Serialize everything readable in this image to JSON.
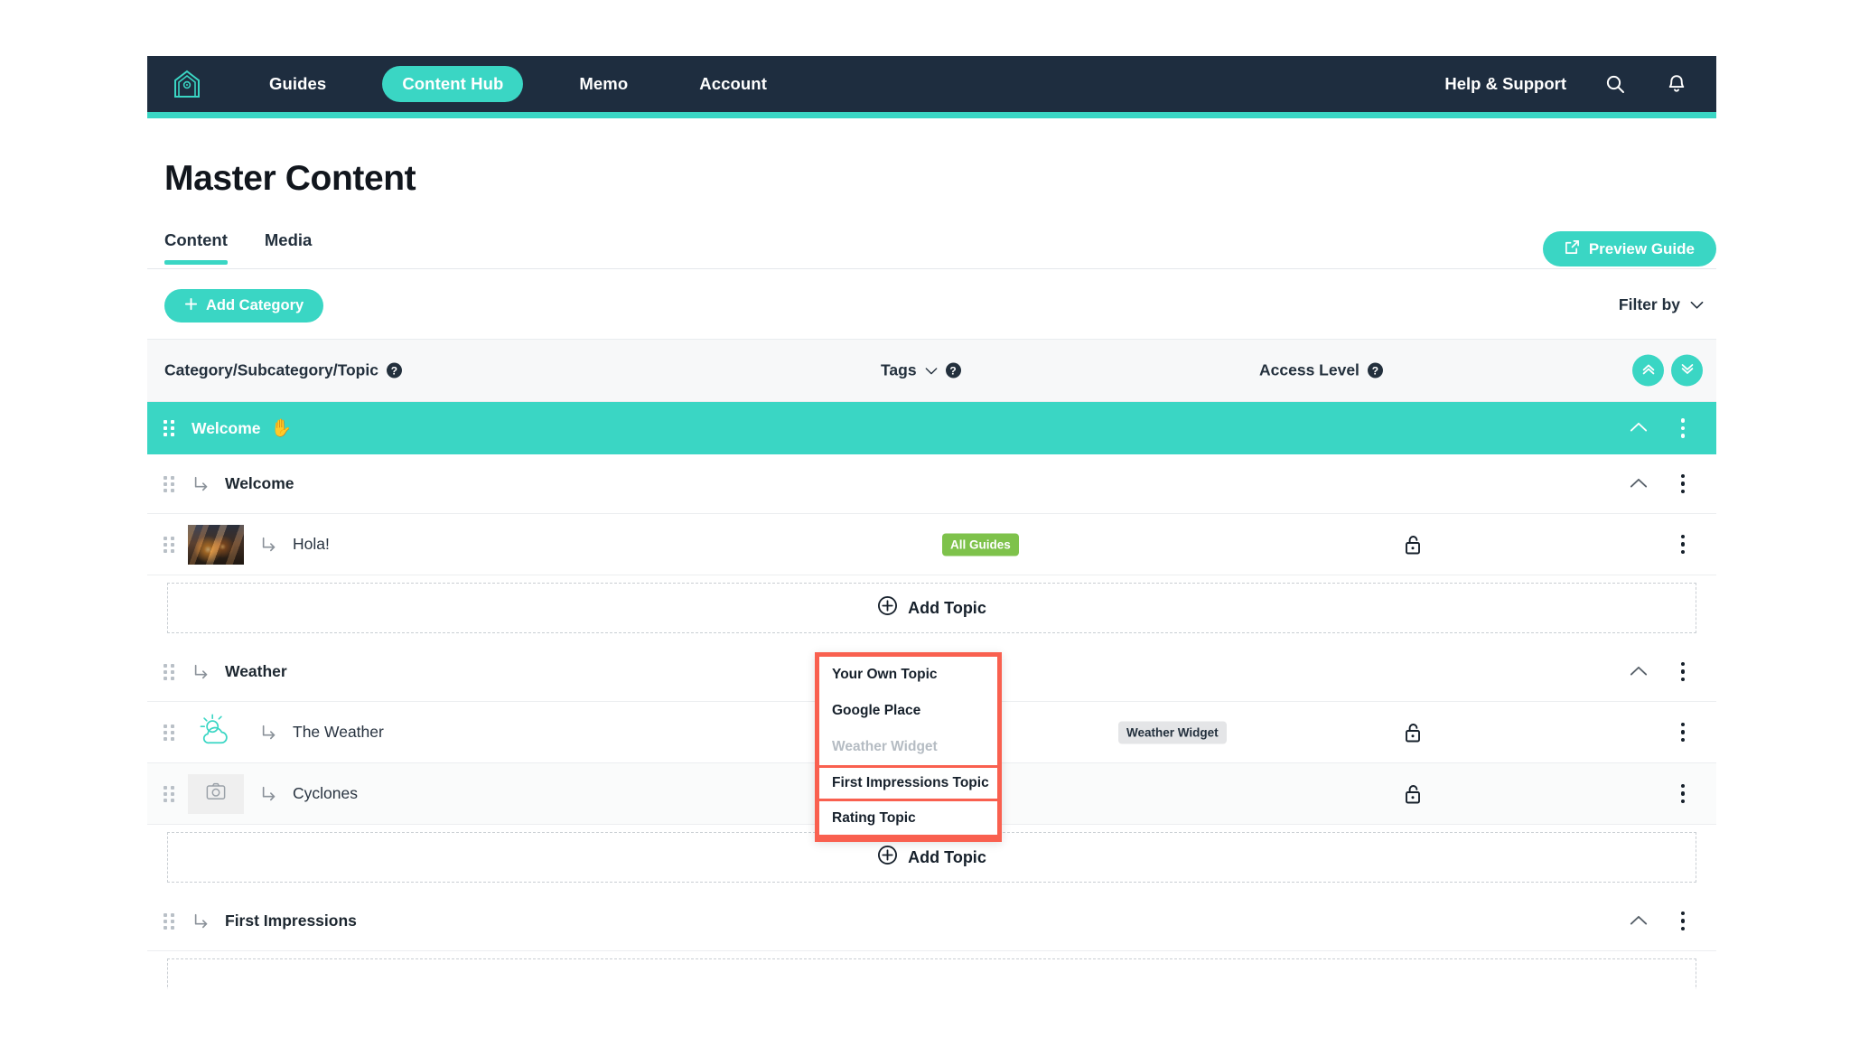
{
  "colors": {
    "brand_teal": "#3ad6c4",
    "navbar_dark": "#1e2d3f",
    "badge_green": "#7ec24b",
    "badge_gray": "#e4e5e7",
    "highlight_red": "#f9604f",
    "text_dark": "#16202b"
  },
  "navbar": {
    "home_icon": "home-icon",
    "links": [
      {
        "label": "Guides",
        "active": false
      },
      {
        "label": "Content Hub",
        "active": true
      },
      {
        "label": "Memo",
        "active": false
      },
      {
        "label": "Account",
        "active": false
      }
    ],
    "help_label": "Help & Support",
    "search_icon": "search-icon",
    "bell_icon": "bell-icon"
  },
  "header": {
    "title": "Master Content",
    "tabs": [
      {
        "label": "Content",
        "active": true
      },
      {
        "label": "Media",
        "active": false
      }
    ],
    "preview_button": "Preview Guide",
    "preview_icon": "external-link-icon"
  },
  "toolbar": {
    "add_category_label": "Add Category",
    "add_category_icon": "plus-icon",
    "filter_label": "Filter by",
    "filter_icon": "chevron-down-icon"
  },
  "table_header": {
    "category_col": "Category/Subcategory/Topic",
    "tags_col": "Tags",
    "access_col": "Access Level",
    "help_glyph": "?",
    "expand_all_icon": "double-chevron-up-icon",
    "collapse_all_icon": "double-chevron-down-icon"
  },
  "add_topic": {
    "label": "Add Topic",
    "icon": "plus-circle-icon"
  },
  "tree": [
    {
      "type": "category",
      "label": "Welcome",
      "emoji": "✋",
      "collapse_icon": "chevron-up-icon",
      "menu_icon": "kebab-menu-icon"
    },
    {
      "type": "subcategory",
      "label": "Welcome",
      "collapse_icon": "chevron-up-icon",
      "menu_icon": "kebab-menu-icon"
    },
    {
      "type": "topic",
      "label": "Hola!",
      "thumbnail": "photo-thumbnail",
      "tag": "All Guides",
      "tag_style": "green",
      "access_icon": "unlocked-padlock-icon",
      "menu_icon": "kebab-menu-icon"
    },
    {
      "type": "add_topic"
    },
    {
      "type": "subcategory",
      "label": "Weather",
      "collapse_icon": "chevron-up-icon",
      "menu_icon": "kebab-menu-icon"
    },
    {
      "type": "topic",
      "label": "The Weather",
      "thumbnail": "sun-cloud-icon",
      "tag": "Weather Widget",
      "tag_style": "gray",
      "access_icon": "unlocked-padlock-icon",
      "menu_icon": "kebab-menu-icon"
    },
    {
      "type": "topic",
      "label": "Cyclones",
      "thumbnail": "camera-placeholder-icon",
      "tag": "",
      "tag_style": "none",
      "access_icon": "unlocked-padlock-icon",
      "menu_icon": "kebab-menu-icon"
    },
    {
      "type": "add_topic"
    },
    {
      "type": "subcategory",
      "label": "First Impressions",
      "collapse_icon": "chevron-up-icon",
      "menu_icon": "kebab-menu-icon"
    }
  ],
  "dropdown_menu": {
    "open": true,
    "highlighted": true,
    "items": [
      {
        "label": "Your Own Topic",
        "disabled": false,
        "outlined": false
      },
      {
        "label": "Google Place",
        "disabled": false,
        "outlined": false
      },
      {
        "label": "Weather Widget",
        "disabled": true,
        "outlined": false
      },
      {
        "label": "First Impressions Topic",
        "disabled": false,
        "outlined": true
      },
      {
        "label": "Rating Topic",
        "disabled": false,
        "outlined": true
      }
    ]
  }
}
